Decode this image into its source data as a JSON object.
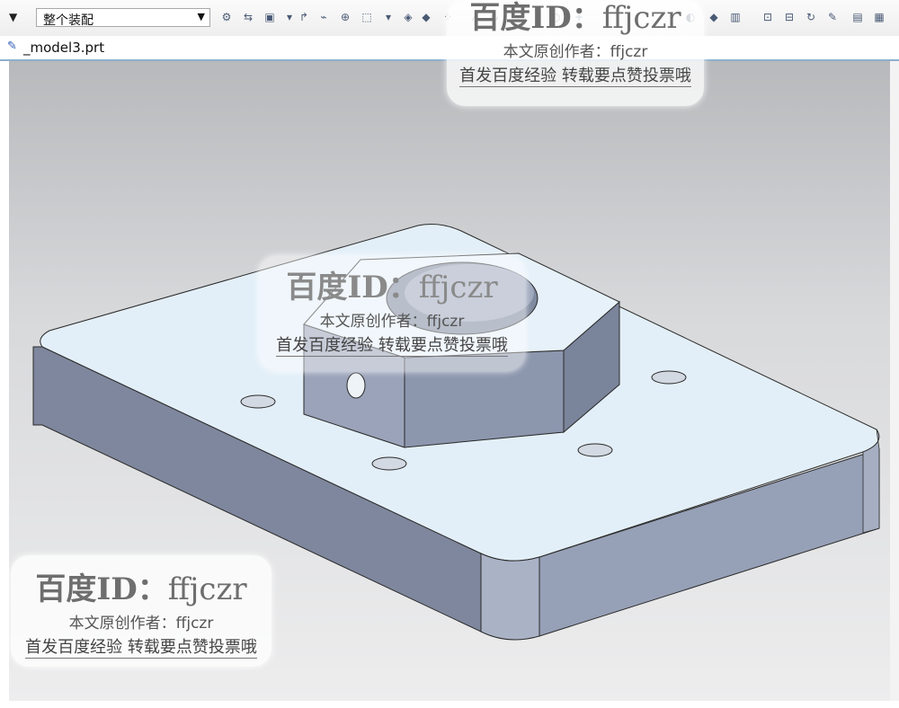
{
  "toolbar": {
    "selection_filter_value": "整个装配",
    "dropdown_glyph": "▼",
    "tools": [
      {
        "name": "assembly-tool-icon",
        "glyph": "⚙"
      },
      {
        "name": "component-icon",
        "glyph": "⇆"
      },
      {
        "name": "snap-point-icon",
        "glyph": "▣"
      },
      {
        "name": "dropdown-icon",
        "glyph": "▾"
      },
      {
        "name": "move-icon",
        "glyph": "↱"
      },
      {
        "name": "filter-icon",
        "glyph": "⌁"
      },
      {
        "name": "select-icon",
        "glyph": "⊕"
      },
      {
        "name": "box-select-icon",
        "glyph": "⬚"
      },
      {
        "name": "dropdown-icon",
        "glyph": "▾"
      },
      {
        "name": "shaded-icon",
        "glyph": "◈"
      },
      {
        "name": "cube-icon",
        "glyph": "◆"
      },
      {
        "name": "grid-icon",
        "glyph": "⁘"
      },
      {
        "name": "line-icon",
        "glyph": "⁄"
      },
      {
        "name": "curve-icon",
        "glyph": "∿"
      },
      {
        "name": "arc-icon",
        "glyph": "⌒"
      },
      {
        "name": "point-icon",
        "glyph": "·"
      },
      {
        "name": "circle-icon",
        "glyph": "○"
      },
      {
        "name": "cross-icon",
        "glyph": "+"
      },
      {
        "name": "view-icon",
        "glyph": "◐"
      },
      {
        "name": "render-icon",
        "glyph": "◆"
      },
      {
        "name": "layer-icon",
        "glyph": "▥"
      },
      {
        "name": "zoom-fit-icon",
        "glyph": "⊡"
      },
      {
        "name": "zoom-window-icon",
        "glyph": "⊟"
      },
      {
        "name": "rotate-icon",
        "glyph": "↻"
      },
      {
        "name": "paint-icon",
        "glyph": "✎"
      },
      {
        "name": "print-icon",
        "glyph": "▤"
      },
      {
        "name": "settings-icon",
        "glyph": "▦"
      }
    ]
  },
  "tab": {
    "icon": "part-file-icon",
    "icon_glyph": "✎",
    "label": "_model3.prt"
  },
  "model_colors": {
    "top_face": "#e6f1f9",
    "side_dark": "#8691a8",
    "side_mid": "#9ea8bd",
    "edge": "#2a2a2a",
    "hole": "#c9cfd8"
  },
  "watermarks": [
    {
      "id": "wm-top",
      "prefix": "百度ID：",
      "handle": "ffjczr",
      "line2": "本文原创作者：ffjczr",
      "line3": "首发百度经验 转载要点赞投票哦"
    },
    {
      "id": "wm-center",
      "prefix": "百度ID：",
      "handle": "ffjczr",
      "line2": "本文原创作者：ffjczr",
      "line3": "首发百度经验 转载要点赞投票哦"
    },
    {
      "id": "wm-bottom-left",
      "prefix": "百度ID：",
      "handle": "ffjczr",
      "line2": "本文原创作者：ffjczr",
      "line3": "首发百度经验 转载要点赞投票哦"
    }
  ]
}
